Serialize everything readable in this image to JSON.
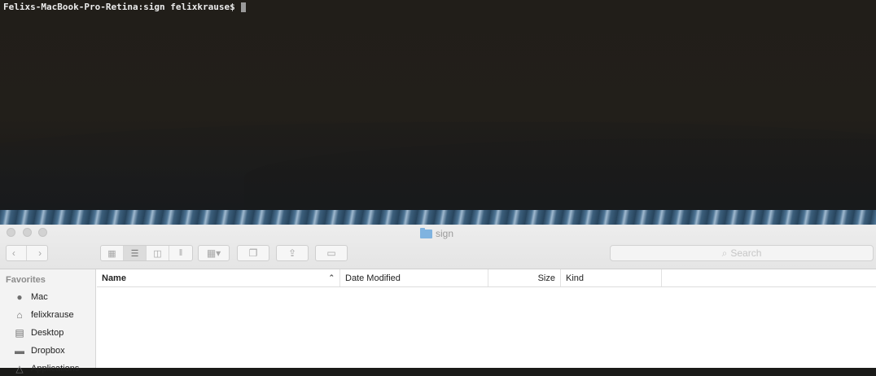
{
  "terminal": {
    "prompt": "Felixs-MacBook-Pro-Retina:sign felixkrause$"
  },
  "finder": {
    "title": "sign",
    "search_placeholder": "Search",
    "sidebar": {
      "heading": "Favorites",
      "items": [
        {
          "label": "Mac",
          "icon": "apple-icon"
        },
        {
          "label": "felixkrause",
          "icon": "home-icon"
        },
        {
          "label": "Desktop",
          "icon": "desktop-icon"
        },
        {
          "label": "Dropbox",
          "icon": "folder-icon"
        },
        {
          "label": "Applications",
          "icon": "applications-icon"
        }
      ]
    },
    "columns": {
      "name": "Name",
      "date_modified": "Date Modified",
      "size": "Size",
      "kind": "Kind"
    }
  }
}
